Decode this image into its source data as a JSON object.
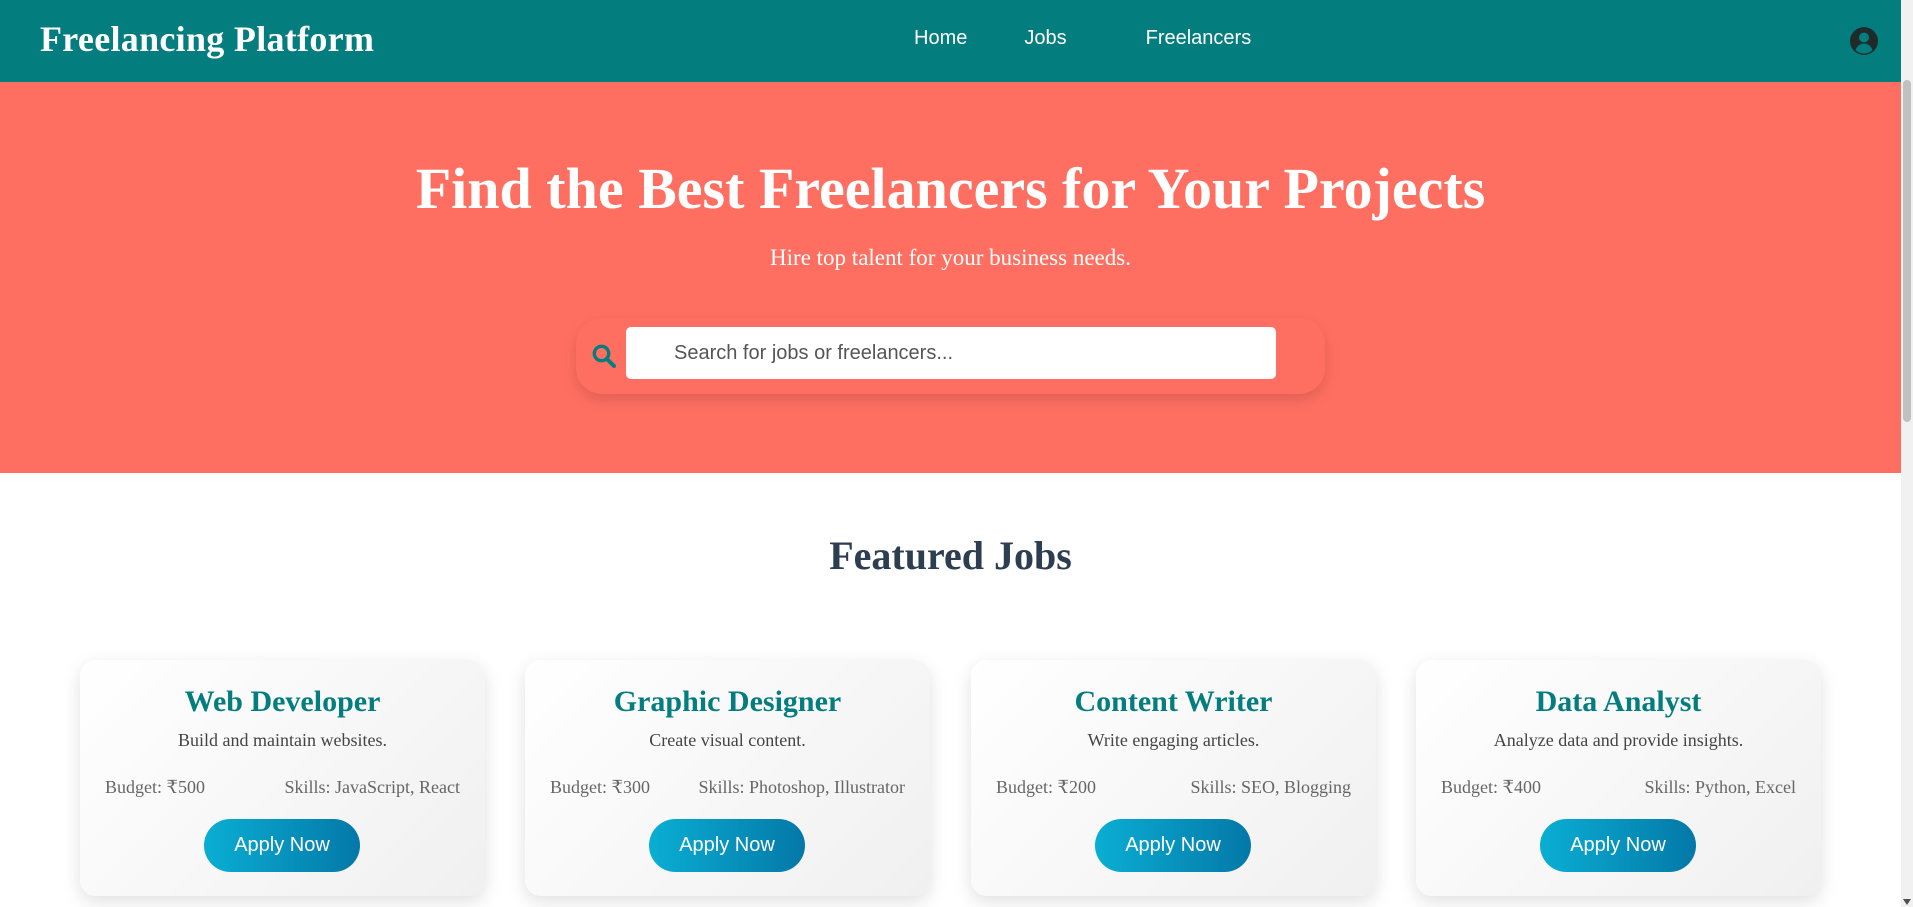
{
  "navbar": {
    "brand": "Freelancing Platform",
    "links": [
      "Home",
      "Jobs",
      "Freelancers"
    ],
    "profile_icon": "user-circle-icon"
  },
  "hero": {
    "title": "Find the Best Freelancers for Your Projects",
    "subtitle": "Hire top talent for your business needs.",
    "search": {
      "placeholder": "Search for jobs or freelancers...",
      "value": "",
      "icon": "search-icon"
    }
  },
  "featured": {
    "title": "Featured Jobs",
    "jobs": [
      {
        "title": "Web Developer",
        "description": "Build and maintain websites.",
        "budget": "Budget: ₹500",
        "skills": "Skills: JavaScript, React",
        "button": "Apply Now"
      },
      {
        "title": "Graphic Designer",
        "description": "Create visual content.",
        "budget": "Budget: ₹300",
        "skills": "Skills: Photoshop, Illustrator",
        "button": "Apply Now"
      },
      {
        "title": "Content Writer",
        "description": "Write engaging articles.",
        "budget": "Budget: ₹200",
        "skills": "Skills: SEO, Blogging",
        "button": "Apply Now"
      },
      {
        "title": "Data Analyst",
        "description": "Analyze data and provide insights.",
        "budget": "Budget: ₹400",
        "skills": "Skills: Python, Excel",
        "button": "Apply Now"
      }
    ]
  },
  "colors": {
    "navbar": "#047d7f",
    "hero": "#ff6f61",
    "heading": "#2c3e50",
    "accent": "#047d7f",
    "button_start": "#0aaed3",
    "button_end": "#0478a8"
  }
}
